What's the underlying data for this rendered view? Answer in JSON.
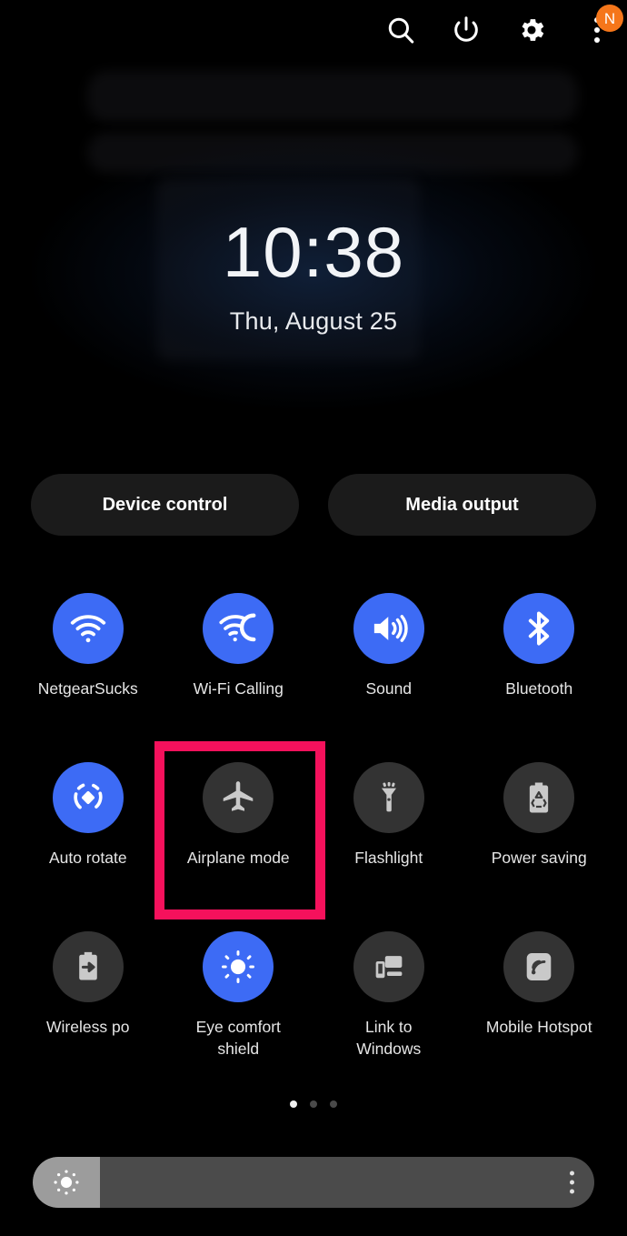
{
  "colors": {
    "background": "#000000",
    "tile_active": "#3D6BF5",
    "tile_inactive": "#333333",
    "highlight": "#F5115C",
    "badge": "#F5761A",
    "pill_bg": "#1B1B1B",
    "slider_track": "#4B4B4B",
    "slider_fill": "#9C9C9C"
  },
  "statusbar": {
    "icons": [
      {
        "name": "search-icon",
        "label": "Search"
      },
      {
        "name": "power-icon",
        "label": "Power off"
      },
      {
        "name": "gear-icon",
        "label": "Settings"
      },
      {
        "name": "kebab-menu-icon",
        "label": "More options"
      }
    ],
    "badge_text": "N"
  },
  "clock": {
    "time": "10:38",
    "date": "Thu, August 25"
  },
  "pills": [
    {
      "label": "Device control",
      "name": "device-control-button"
    },
    {
      "label": "Media output",
      "name": "media-output-button"
    }
  ],
  "tiles": [
    {
      "label": "NetgearSucks",
      "icon": "wifi-icon",
      "state": "on",
      "name": "tile-wifi"
    },
    {
      "label": "Wi-Fi Calling",
      "icon": "wifi-calling-icon",
      "state": "on",
      "name": "tile-wifi-calling"
    },
    {
      "label": "Sound",
      "icon": "sound-icon",
      "state": "on",
      "name": "tile-sound"
    },
    {
      "label": "Bluetooth",
      "icon": "bluetooth-icon",
      "state": "on",
      "name": "tile-bluetooth"
    },
    {
      "label": "Auto rotate",
      "icon": "auto-rotate-icon",
      "state": "on",
      "name": "tile-auto-rotate"
    },
    {
      "label": "Airplane mode",
      "icon": "airplane-icon",
      "state": "off",
      "name": "tile-airplane-mode",
      "highlighted": true
    },
    {
      "label": "Flashlight",
      "icon": "flashlight-icon",
      "state": "off",
      "name": "tile-flashlight"
    },
    {
      "label": "Power saving",
      "icon": "power-saving-icon",
      "state": "off",
      "name": "tile-power-saving"
    },
    {
      "label": "Wireless po",
      "icon": "wireless-power-sharing-icon",
      "state": "off",
      "name": "tile-wireless-power-sharing"
    },
    {
      "label": "Eye comfort shield",
      "icon": "eye-comfort-shield-icon",
      "state": "on",
      "name": "tile-eye-comfort-shield"
    },
    {
      "label": "Link to Windows",
      "icon": "link-to-windows-icon",
      "state": "off",
      "name": "tile-link-to-windows"
    },
    {
      "label": "Mobile Hotspot",
      "icon": "mobile-hotspot-icon",
      "state": "off",
      "name": "tile-mobile-hotspot"
    }
  ],
  "pagination": {
    "total": 3,
    "active_index": 0
  },
  "brightness": {
    "value_percent": 12,
    "icon": "brightness-sun-icon",
    "menu_icon": "kebab-menu-icon"
  }
}
